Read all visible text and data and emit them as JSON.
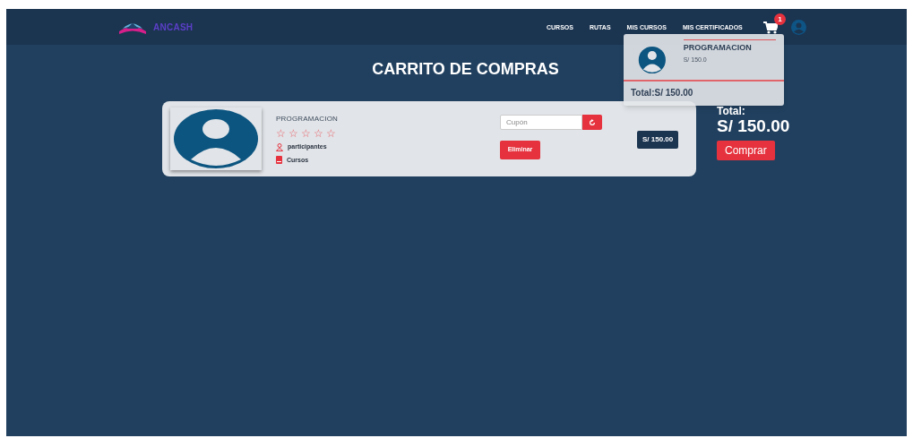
{
  "logo": {
    "text": "ANCASH"
  },
  "nav": {
    "items": [
      {
        "label": "CURSOS"
      },
      {
        "label": "RUTAS"
      },
      {
        "label": "MIS CURSOS"
      },
      {
        "label": "MIS CERTIFICADOS"
      }
    ],
    "cart_count": "1"
  },
  "cart_dropdown": {
    "items": [
      {
        "title": "PROGRAMACION",
        "price": "S/ 150.0"
      }
    ],
    "total": "Total:S/ 150.00"
  },
  "title": "CARRITO DE COMPRAS",
  "cart_items": [
    {
      "title": "PROGRAMACION",
      "stars": 0,
      "participants": "participantes",
      "courses": "Cursos",
      "coupon_placeholder": "Cupón",
      "remove": "Eliminar",
      "price": "S/ 150.00"
    }
  ],
  "summary": {
    "label": "Total:",
    "amount": "S/ 150.00",
    "buy": "Comprar"
  }
}
